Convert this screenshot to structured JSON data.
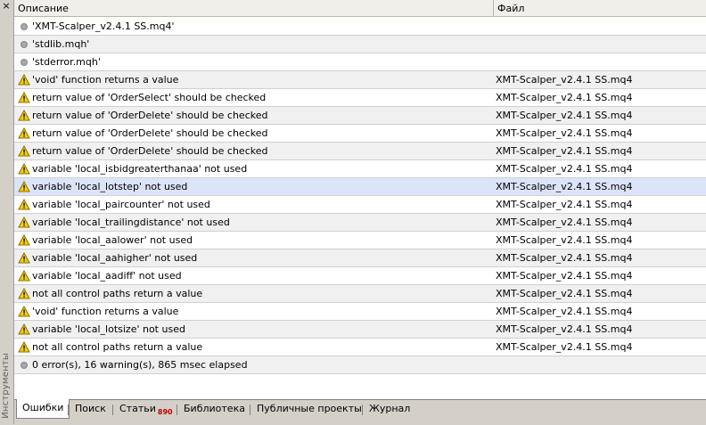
{
  "side_panel": {
    "close_label": "×",
    "title": "Инструменты"
  },
  "columns": {
    "description": "Описание",
    "file": "Файл"
  },
  "rows": [
    {
      "icon": "info-dot-icon",
      "description": "'XMT-Scalper_v2.4.1 SS.mq4'",
      "file": ""
    },
    {
      "icon": "info-dot-icon",
      "description": "'stdlib.mqh'",
      "file": ""
    },
    {
      "icon": "info-dot-icon",
      "description": "'stderror.mqh'",
      "file": ""
    },
    {
      "icon": "warning-icon",
      "description": "'void' function returns a value",
      "file": "XMT-Scalper_v2.4.1 SS.mq4"
    },
    {
      "icon": "warning-icon",
      "description": "return value of 'OrderSelect' should be checked",
      "file": "XMT-Scalper_v2.4.1 SS.mq4"
    },
    {
      "icon": "warning-icon",
      "description": "return value of 'OrderDelete' should be checked",
      "file": "XMT-Scalper_v2.4.1 SS.mq4"
    },
    {
      "icon": "warning-icon",
      "description": "return value of 'OrderDelete' should be checked",
      "file": "XMT-Scalper_v2.4.1 SS.mq4"
    },
    {
      "icon": "warning-icon",
      "description": "return value of 'OrderDelete' should be checked",
      "file": "XMT-Scalper_v2.4.1 SS.mq4"
    },
    {
      "icon": "warning-icon",
      "description": "variable 'local_isbidgreaterthanaa' not used",
      "file": "XMT-Scalper_v2.4.1 SS.mq4"
    },
    {
      "icon": "warning-icon",
      "description": "variable 'local_lotstep' not used",
      "file": "XMT-Scalper_v2.4.1 SS.mq4"
    },
    {
      "icon": "warning-icon",
      "description": "variable 'local_paircounter' not used",
      "file": "XMT-Scalper_v2.4.1 SS.mq4"
    },
    {
      "icon": "warning-icon",
      "description": "variable 'local_trailingdistance' not used",
      "file": "XMT-Scalper_v2.4.1 SS.mq4"
    },
    {
      "icon": "warning-icon",
      "description": "variable 'local_aalower' not used",
      "file": "XMT-Scalper_v2.4.1 SS.mq4"
    },
    {
      "icon": "warning-icon",
      "description": "variable 'local_aahigher' not used",
      "file": "XMT-Scalper_v2.4.1 SS.mq4"
    },
    {
      "icon": "warning-icon",
      "description": "variable 'local_aadiff' not used",
      "file": "XMT-Scalper_v2.4.1 SS.mq4"
    },
    {
      "icon": "warning-icon",
      "description": "not all control paths return a value",
      "file": "XMT-Scalper_v2.4.1 SS.mq4"
    },
    {
      "icon": "warning-icon",
      "description": "'void' function returns a value",
      "file": "XMT-Scalper_v2.4.1 SS.mq4"
    },
    {
      "icon": "warning-icon",
      "description": "variable 'local_lotsize' not used",
      "file": "XMT-Scalper_v2.4.1 SS.mq4"
    },
    {
      "icon": "warning-icon",
      "description": "not all control paths return a value",
      "file": "XMT-Scalper_v2.4.1 SS.mq4"
    },
    {
      "icon": "info-dot-icon",
      "description": "0 error(s), 16 warning(s), 865 msec elapsed",
      "file": ""
    }
  ],
  "selected_row": 9,
  "tabs": [
    {
      "name": "errors",
      "label": "Ошибки",
      "badge": "",
      "active": true
    },
    {
      "name": "search",
      "label": "Поиск",
      "badge": "",
      "active": false
    },
    {
      "name": "articles",
      "label": "Статьи",
      "badge": "890",
      "active": false
    },
    {
      "name": "library",
      "label": "Библиотека",
      "badge": "",
      "active": false
    },
    {
      "name": "public-projects",
      "label": "Публичные проекты",
      "badge": "",
      "active": false
    },
    {
      "name": "journal",
      "label": "Журнал",
      "badge": "",
      "active": false
    }
  ],
  "colors": {
    "warning_fill": "#f5d000",
    "warning_border": "#8a6d00",
    "badge": "#c00000",
    "selection": "#dce4fa"
  }
}
